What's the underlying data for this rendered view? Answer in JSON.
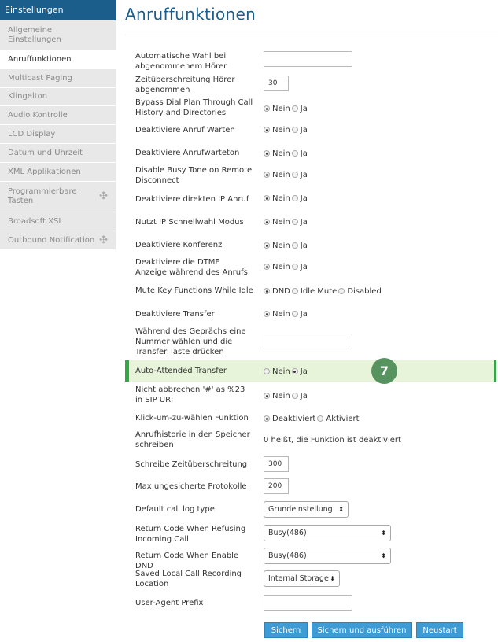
{
  "sidebar": {
    "title": "Einstellungen",
    "items": [
      {
        "label": "Allgemeine Einstellungen",
        "active": false,
        "expandable": false
      },
      {
        "label": "Anruffunktionen",
        "active": true,
        "expandable": false
      },
      {
        "label": "Multicast Paging",
        "active": false,
        "expandable": false
      },
      {
        "label": "Klingelton",
        "active": false,
        "expandable": false
      },
      {
        "label": "Audio Kontrolle",
        "active": false,
        "expandable": false
      },
      {
        "label": "LCD Display",
        "active": false,
        "expandable": false
      },
      {
        "label": "Datum und Uhrzeit",
        "active": false,
        "expandable": false
      },
      {
        "label": "XML Applikationen",
        "active": false,
        "expandable": false
      },
      {
        "label": "Programmierbare Tasten",
        "active": false,
        "expandable": true
      },
      {
        "label": "Broadsoft XSI",
        "active": false,
        "expandable": false
      },
      {
        "label": "Outbound Notification",
        "active": false,
        "expandable": true
      }
    ]
  },
  "page_title": "Anruffunktionen",
  "fields": [
    {
      "label": "Automatische Wahl bei abgenommenem Hörer",
      "type": "text",
      "value": ""
    },
    {
      "label": "Zeitüberschreitung Hörer abgenommen",
      "type": "text",
      "value": "30"
    },
    {
      "label": "Bypass Dial Plan Through Call History and Directories",
      "type": "radio",
      "options": [
        "Nein",
        "Ja"
      ],
      "selected": 0
    },
    {
      "label": "Deaktiviere Anruf Warten",
      "type": "radio",
      "options": [
        "Nein",
        "Ja"
      ],
      "selected": 0
    },
    {
      "label": "Deaktiviere Anrufwarteton",
      "type": "radio",
      "options": [
        "Nein",
        "Ja"
      ],
      "selected": 0
    },
    {
      "label": "Disable Busy Tone on Remote Disconnect",
      "type": "radio",
      "options": [
        "Nein",
        "Ja"
      ],
      "selected": 0
    },
    {
      "label": "Deaktiviere direkten IP Anruf",
      "type": "radio",
      "options": [
        "Nein",
        "Ja"
      ],
      "selected": 0
    },
    {
      "label": "Nutzt IP Schnellwahl Modus",
      "type": "radio",
      "options": [
        "Nein",
        "Ja"
      ],
      "selected": 0
    },
    {
      "label": "Deaktiviere Konferenz",
      "type": "radio",
      "options": [
        "Nein",
        "Ja"
      ],
      "selected": 0
    },
    {
      "label": "Deaktiviere die DTMF Anzeige während des Anrufs",
      "type": "radio",
      "options": [
        "Nein",
        "Ja"
      ],
      "selected": 0
    },
    {
      "label": "Mute Key Functions While Idle",
      "type": "radio",
      "options": [
        "DND",
        "Idle Mute",
        "Disabled"
      ],
      "selected": 0
    },
    {
      "label": "Deaktiviere Transfer",
      "type": "radio",
      "options": [
        "Nein",
        "Ja"
      ],
      "selected": 0
    },
    {
      "label": "Während des Geprächs eine Nummer wählen und die Transfer Taste drücken",
      "type": "text",
      "value": ""
    },
    {
      "label": "Auto-Attended Transfer",
      "type": "radio",
      "options": [
        "Nein",
        "Ja"
      ],
      "selected": 1,
      "highlighted": true,
      "badge": "7"
    },
    {
      "label": "Nicht abbrechen '#' as %23 in SIP URI",
      "type": "radio",
      "options": [
        "Nein",
        "Ja"
      ],
      "selected": 0
    },
    {
      "label": "Klick-um-zu-wählen Funktion",
      "type": "radio",
      "options": [
        "Deaktiviert",
        "Aktiviert"
      ],
      "selected": 0
    },
    {
      "label": "Anrufhistorie in den Speicher schreiben",
      "type": "static",
      "value": "0 heißt, die Funktion ist deaktiviert"
    },
    {
      "label": "Schreibe Zeitüberschreitung",
      "type": "text",
      "value": "300"
    },
    {
      "label": "Max ungesicherte Protokolle",
      "type": "text",
      "value": "200"
    },
    {
      "label": "Default call log type",
      "type": "select",
      "value": "Grundeinstellung"
    },
    {
      "label": "Return Code When Refusing Incoming Call",
      "type": "select",
      "value": "Busy(486)"
    },
    {
      "label": "Return Code When Enable DND",
      "type": "select",
      "value": "Busy(486)"
    },
    {
      "label": "Saved Local Call Recording Location",
      "type": "select",
      "value": "Internal Storage"
    },
    {
      "label": "User-Agent Prefix",
      "type": "text",
      "value": ""
    }
  ],
  "buttons": {
    "save": "Sichern",
    "save_apply": "Sichern und ausführen",
    "restart": "Neustart"
  },
  "colors": {
    "accent": "#1c5e8b",
    "button": "#3f9bd3",
    "highlight_bg": "#e7f4d9",
    "highlight_border": "#34a745",
    "badge": "#56935e"
  }
}
